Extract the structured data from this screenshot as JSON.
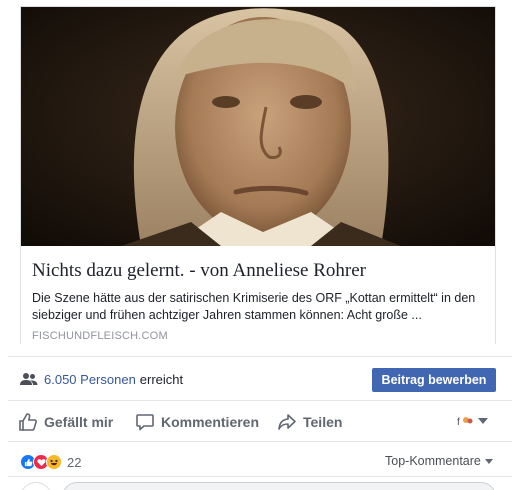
{
  "post": {
    "card": {
      "title": "Nichts dazu gelernt. - von Anneliese Rohrer",
      "description": "Die Szene hätte aus der satirischen Krimiserie des ORF „Kottan ermittelt“ in den siebziger und frühen achtziger Jahren stammen können: Acht große ...",
      "domain": "FISCHUNDFLEISCH.COM"
    },
    "reach": {
      "count": "6.050 Personen",
      "verb": "erreicht"
    },
    "boost_label": "Beitrag bewerben",
    "actions": {
      "like": "Gefällt mir",
      "comment": "Kommentieren",
      "share": "Teilen"
    },
    "reactions": {
      "count": "22",
      "sort_label": "Top-Kommentare"
    }
  },
  "colors": {
    "link": "#365899",
    "boost_button": "#4267b2",
    "like_reaction": "#1877f2",
    "love_reaction": "#f0284a",
    "haha_reaction": "#f7b928"
  }
}
